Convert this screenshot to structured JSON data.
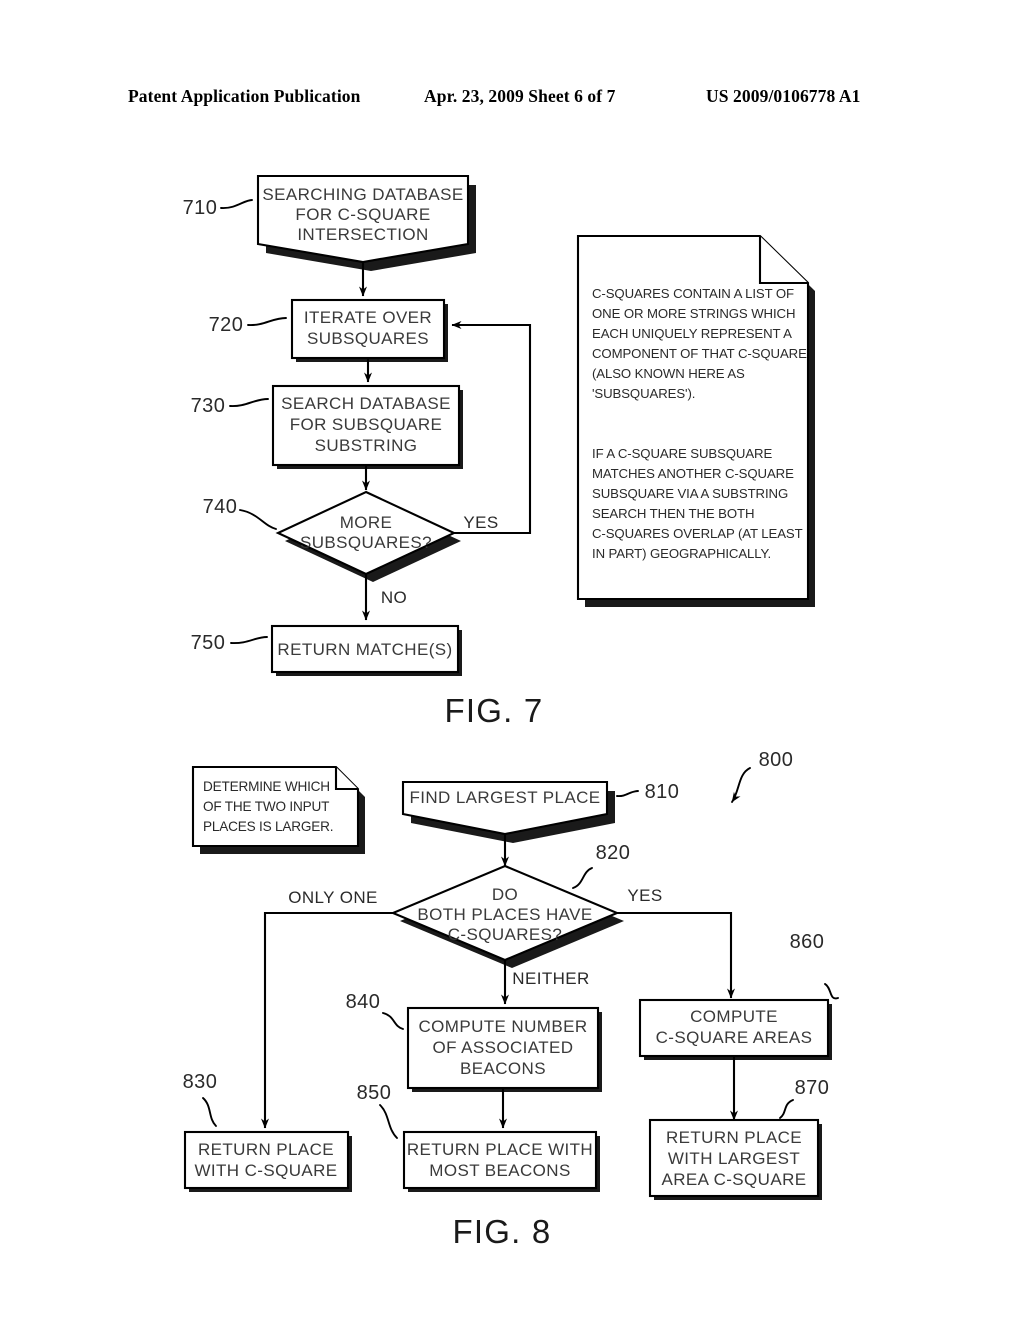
{
  "header": {
    "publication": "Patent Application Publication",
    "date_sheet": "Apr. 23, 2009  Sheet 6 of 7",
    "patent_number": "US 2009/0106778 A1"
  },
  "figures": [
    {
      "caption": "FIG. 7",
      "nodes": [
        {
          "ref": "710",
          "shape": "chevron-terminator",
          "lines": [
            "SEARCHING DATABASE",
            "FOR C-SQUARE",
            "INTERSECTION"
          ]
        },
        {
          "ref": "720",
          "shape": "process",
          "lines": [
            "ITERATE OVER",
            "SUBSQUARES"
          ]
        },
        {
          "ref": "730",
          "shape": "process",
          "lines": [
            "SEARCH DATABASE",
            "FOR SUBSQUARE",
            "SUBSTRING"
          ]
        },
        {
          "ref": "740",
          "shape": "decision",
          "lines": [
            "MORE",
            "SUBSQUARES?"
          ]
        },
        {
          "ref": "750",
          "shape": "process",
          "lines": [
            "RETURN MATCHE(S)"
          ]
        }
      ],
      "edge_labels": [
        "YES",
        "NO"
      ],
      "note": {
        "lines": [
          "C-SQUARES CONTAIN A LIST OF",
          "ONE OR MORE STRINGS WHICH",
          "EACH UNIQUELY REPRESENT A",
          "COMPONENT OF THAT C-SQUARE",
          "(ALSO KNOWN HERE AS",
          "'SUBSQUARES').",
          "",
          "IF A C-SQUARE SUBSQUARE",
          "MATCHES ANOTHER C-SQUARE",
          "SUBSQUARE VIA A SUBSTRING",
          "SEARCH THEN THE BOTH",
          "C-SQUARES OVERLAP (AT LEAST",
          "IN PART) GEOGRAPHICALLY."
        ]
      }
    },
    {
      "caption": "FIG. 8",
      "diagram_ref": "800",
      "nodes": [
        {
          "ref": "810",
          "shape": "chevron-terminator",
          "lines": [
            "FIND LARGEST PLACE"
          ]
        },
        {
          "ref": "820",
          "shape": "decision",
          "lines": [
            "DO",
            "BOTH PLACES HAVE",
            "C-SQUARES?"
          ]
        },
        {
          "ref": "830",
          "shape": "process",
          "lines": [
            "RETURN PLACE",
            "WITH C-SQUARE"
          ]
        },
        {
          "ref": "840",
          "shape": "process",
          "lines": [
            "COMPUTE NUMBER",
            "OF ASSOCIATED",
            "BEACONS"
          ]
        },
        {
          "ref": "850",
          "shape": "process",
          "lines": [
            "RETURN PLACE WITH",
            "MOST BEACONS"
          ]
        },
        {
          "ref": "860",
          "shape": "process",
          "lines": [
            "COMPUTE",
            "C-SQUARE AREAS"
          ]
        },
        {
          "ref": "870",
          "shape": "process",
          "lines": [
            "RETURN PLACE",
            "WITH LARGEST",
            "AREA C-SQUARE"
          ]
        }
      ],
      "edge_labels": [
        "ONLY ONE",
        "YES",
        "NEITHER"
      ],
      "note": {
        "lines": [
          "DETERMINE WHICH",
          "OF THE TWO INPUT",
          "PLACES IS LARGER."
        ]
      }
    }
  ],
  "text": {
    "f7_710_l1": "SEARCHING DATABASE",
    "f7_710_l2": "FOR C-SQUARE",
    "f7_710_l3": "INTERSECTION",
    "f7_720_l1": "ITERATE OVER",
    "f7_720_l2": "SUBSQUARES",
    "f7_730_l1": "SEARCH DATABASE",
    "f7_730_l2": "FOR SUBSQUARE",
    "f7_730_l3": "SUBSTRING",
    "f7_740_l1": "MORE",
    "f7_740_l2": "SUBSQUARES?",
    "f7_750_l1": "RETURN MATCHE(S)",
    "f7_ref710": "710",
    "f7_ref720": "720",
    "f7_ref730": "730",
    "f7_ref740": "740",
    "f7_ref750": "750",
    "f7_yes": "YES",
    "f7_no": "NO",
    "f7_note_1": "C-SQUARES CONTAIN A LIST OF",
    "f7_note_2": "ONE OR MORE STRINGS WHICH",
    "f7_note_3": "EACH UNIQUELY REPRESENT A",
    "f7_note_4": "COMPONENT OF THAT C-SQUARE",
    "f7_note_5": "(ALSO KNOWN HERE AS",
    "f7_note_6": "'SUBSQUARES').",
    "f7_note_7": "IF A C-SQUARE SUBSQUARE",
    "f7_note_8": "MATCHES ANOTHER C-SQUARE",
    "f7_note_9": "SUBSQUARE VIA A SUBSTRING",
    "f7_note_10": "SEARCH THEN THE BOTH",
    "f7_note_11": "C-SQUARES OVERLAP (AT LEAST",
    "f7_note_12": "IN PART) GEOGRAPHICALLY.",
    "f7_caption": "FIG. 7",
    "f8_note_1": "DETERMINE WHICH",
    "f8_note_2": "OF THE TWO INPUT",
    "f8_note_3": "PLACES IS LARGER.",
    "f8_810_l1": "FIND LARGEST PLACE",
    "f8_820_l1": "DO",
    "f8_820_l2": "BOTH PLACES HAVE",
    "f8_820_l3": "C-SQUARES?",
    "f8_830_l1": "RETURN PLACE",
    "f8_830_l2": "WITH C-SQUARE",
    "f8_840_l1": "COMPUTE NUMBER",
    "f8_840_l2": "OF ASSOCIATED",
    "f8_840_l3": "BEACONS",
    "f8_850_l1": "RETURN PLACE WITH",
    "f8_850_l2": "MOST BEACONS",
    "f8_860_l1": "COMPUTE",
    "f8_860_l2": "C-SQUARE AREAS",
    "f8_870_l1": "RETURN PLACE",
    "f8_870_l2": "WITH LARGEST",
    "f8_870_l3": "AREA C-SQUARE",
    "f8_ref800": "800",
    "f8_ref810": "810",
    "f8_ref820": "820",
    "f8_ref830": "830",
    "f8_ref840": "840",
    "f8_ref850": "850",
    "f8_ref860": "860",
    "f8_ref870": "870",
    "f8_onlyone": "ONLY ONE",
    "f8_yes": "YES",
    "f8_neither": "NEITHER",
    "f8_caption": "FIG. 8"
  },
  "colors": {
    "ink": "#000000",
    "page": "#ffffff",
    "text_gray": "#3a3a3a"
  }
}
